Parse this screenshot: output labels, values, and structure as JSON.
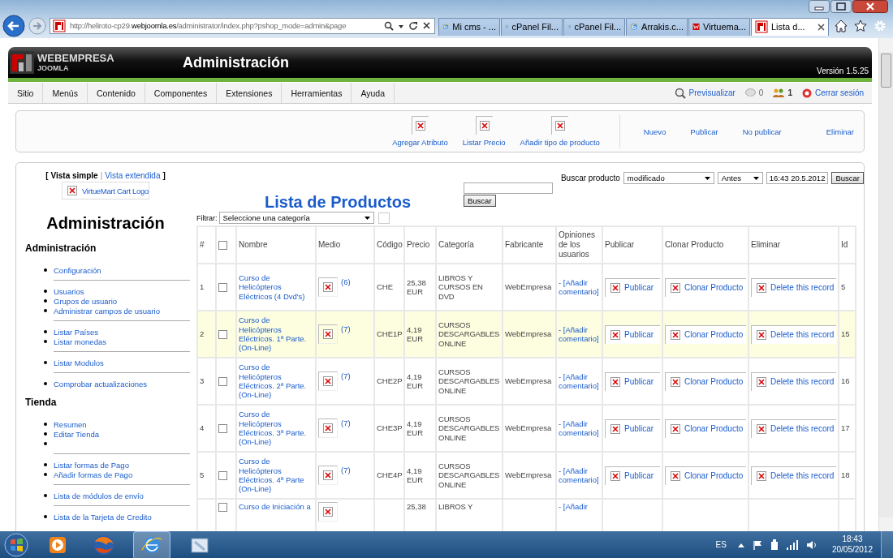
{
  "browser": {
    "url": "http://heliroto-cp29.**webjoomla.es**/administrator/index.php?pshop_mode=admin&page",
    "tabs": [
      {
        "label": "Mi cms - ...",
        "kind": "web",
        "selected": false
      },
      {
        "label": "cPanel Fil...",
        "kind": "web",
        "selected": false
      },
      {
        "label": "cPanel Fil...",
        "kind": "web",
        "selected": false
      },
      {
        "label": "Arrakis.c...",
        "kind": "web",
        "selected": false
      },
      {
        "label": "Virtuema...",
        "kind": "brand",
        "selected": false
      },
      {
        "label": "Lista d...",
        "kind": "site",
        "selected": true
      }
    ]
  },
  "header": {
    "logo_top": "WEBEMPRESA",
    "logo_bottom": "JOOMLA",
    "title": "Administración",
    "version": "Versión 1.5.25"
  },
  "menu": {
    "items": [
      "Sitio",
      "Menús",
      "Contenido",
      "Componentes",
      "Extensiones",
      "Herramientas",
      "Ayuda"
    ],
    "preview": "Previsualizar",
    "messages": "0",
    "users": "1",
    "logout": "Cerrar sesión"
  },
  "toolbar": [
    {
      "label": "Agregar Atributo",
      "kind": "image"
    },
    {
      "label": "Listar Precio",
      "kind": "image"
    },
    {
      "label": "Añadir tipo de producto",
      "kind": "image"
    },
    {
      "label": "Nuevo",
      "kind": "text"
    },
    {
      "label": "Publicar",
      "kind": "text"
    },
    {
      "label": "No publicar",
      "kind": "text"
    },
    {
      "label": "Eliminar",
      "kind": "text"
    }
  ],
  "sidebar": {
    "open": "[",
    "separator": "|",
    "close": "]",
    "views": [
      {
        "label": "Vista simple",
        "selected": true
      },
      {
        "label": "Vista extendida",
        "selected": false
      }
    ],
    "logo_alt": "VirtueMart Cart Logo",
    "heading": "Administración",
    "sections": [
      {
        "title": "Administración",
        "groups": [
          [
            {
              "kind": "link",
              "label": "Configuración"
            }
          ],
          [
            {
              "kind": "link",
              "label": "Usuarios"
            },
            {
              "kind": "link",
              "label": "Grupos de usuario"
            },
            {
              "kind": "link",
              "label": "Administrar campos de usuario"
            }
          ],
          [
            {
              "kind": "link",
              "label": "Listar Países"
            },
            {
              "kind": "link",
              "label": "Listar monedas"
            }
          ],
          [
            {
              "kind": "link",
              "label": "Listar Modulos"
            }
          ],
          [
            {
              "kind": "link",
              "label": "Comprobar actualizaciones"
            }
          ]
        ]
      },
      {
        "title": "Tienda",
        "groups": [
          [
            {
              "kind": "link",
              "label": "Resumen"
            },
            {
              "kind": "link",
              "label": "Editar Tienda"
            },
            {
              "kind": "blank"
            }
          ],
          [
            {
              "kind": "link",
              "label": "Listar formas de Pago"
            },
            {
              "kind": "link",
              "label": "Añadir formas de Pago"
            }
          ],
          [
            {
              "kind": "link",
              "label": "Lista de módulos de envío"
            }
          ],
          [
            {
              "kind": "link",
              "label": "Lista de la Tarjeta de Credito"
            }
          ]
        ]
      }
    ]
  },
  "search": {
    "label": "Buscar producto",
    "field": "modificado",
    "when": "Antes",
    "date": "16:43 20.5.2012",
    "button": "Buscar"
  },
  "page_title": "Lista de Productos",
  "keyword_search": {
    "button": "Buscar"
  },
  "filter": {
    "label": "Filtrar:",
    "category": "Seleccione una categoría"
  },
  "table": {
    "select_all_checked": false,
    "columns": [
      "#",
      "",
      "Nombre",
      "Medio",
      "Código",
      "Precio",
      "Categoría",
      "Fabricante",
      "Opiniones de los usuarios",
      "Publicar",
      "Clonar Producto",
      "Eliminar",
      "Id"
    ],
    "rows": [
      {
        "num": "1",
        "checked": false,
        "highlighted": false,
        "name": "Curso de Helicópteros Eléctricos (4 Dvd's)",
        "media": "(6)",
        "code": "CHE",
        "price": "25,38 EUR",
        "category": "LIBROS Y CURSOS EN DVD",
        "maker": "WebEmpresa",
        "reviews": "- [Añadir comentario]",
        "publish": "Publicar",
        "clone": "Clonar Producto",
        "delete": "Delete this record",
        "id": "5"
      },
      {
        "num": "2",
        "checked": false,
        "highlighted": true,
        "name": "Curso de Helicópteros Eléctricos. 1ª Parte. (On-Line)",
        "media": "(7)",
        "code": "CHE1P",
        "price": "4,19 EUR",
        "category": "CURSOS DESCARGABLES ONLINE",
        "maker": "WebEmpresa",
        "reviews": "- [Añadir comentario]",
        "publish": "Publicar",
        "clone": "Clonar Producto",
        "delete": "Delete this record",
        "id": "15"
      },
      {
        "num": "3",
        "checked": false,
        "highlighted": false,
        "name": "Curso de Helicópteros Eléctricos. 2ª Parte. (On-Line)",
        "media": "(7)",
        "code": "CHE2P",
        "price": "4,19 EUR",
        "category": "CURSOS DESCARGABLES ONLINE",
        "maker": "WebEmpresa",
        "reviews": "- [Añadir comentario]",
        "publish": "Publicar",
        "clone": "Clonar Producto",
        "delete": "Delete this record",
        "id": "16"
      },
      {
        "num": "4",
        "checked": false,
        "highlighted": false,
        "name": "Curso de Helicópteros Eléctricos. 3ª Parte. (On-Line)",
        "media": "(7)",
        "code": "CHE3P",
        "price": "4,19 EUR",
        "category": "CURSOS DESCARGABLES ONLINE",
        "maker": "WebEmpresa",
        "reviews": "- [Añadir comentario]",
        "publish": "Publicar",
        "clone": "Clonar Producto",
        "delete": "Delete this record",
        "id": "17"
      },
      {
        "num": "5",
        "checked": false,
        "highlighted": false,
        "name": "Curso de Helicópteros Eléctricos. 4ª Parte (On-Line)",
        "media": "(7)",
        "code": "CHE4P",
        "price": "4,19 EUR",
        "category": "CURSOS DESCARGABLES ONLINE",
        "maker": "WebEmpresa",
        "reviews": "- [Añadir comentario]",
        "publish": "Publicar",
        "clone": "Clonar Producto",
        "delete": "Delete this record",
        "id": "18"
      },
      {
        "checked": false,
        "highlighted": false,
        "name": "Curso de Iniciación a",
        "price": "25,38",
        "category": "LIBROS Y",
        "reviews": "- [Añadir"
      }
    ]
  },
  "taskbar": {
    "language": "ES",
    "time": "18:43",
    "date": "20/05/2012"
  }
}
